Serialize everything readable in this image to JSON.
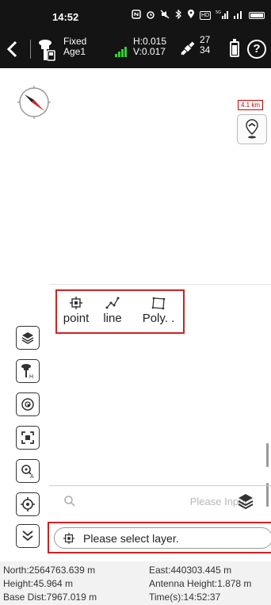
{
  "status_bar": {
    "time": "14:52",
    "icons": [
      "nfc-icon",
      "alarm-icon",
      "mute-icon",
      "bluetooth-icon",
      "location-icon",
      "hd-icon",
      "signal-5g-icon",
      "signal-4g-icon",
      "battery-icon"
    ],
    "hd_label": "HD",
    "net_label": "5G"
  },
  "gnss": {
    "fix": "Fixed",
    "age": "Age1",
    "h_precision": "H:0.015",
    "v_precision": "V:0.017",
    "sats_used": "27",
    "sats_visible": "34",
    "signal_level": 4,
    "accent_color": "#2fd12f"
  },
  "map": {
    "scale": "4.1 km"
  },
  "draw_types": [
    {
      "label": "point",
      "icon": "point-icon"
    },
    {
      "label": "line",
      "icon": "polyline-icon"
    },
    {
      "label": "Poly. .",
      "icon": "polygon-icon"
    }
  ],
  "search": {
    "placeholder": "Please Input"
  },
  "layer_select": {
    "label": "Please select layer."
  },
  "tools": [
    "layers-icon",
    "antenna-height-icon",
    "target-icon",
    "fit-extent-icon",
    "zoom-auto-icon",
    "crosshair-icon",
    "collapse-icon"
  ],
  "info": {
    "north": "North:2564763.639 m",
    "east": "East:440303.445 m",
    "height": "Height:45.964 m",
    "antenna_height": "Antenna Height:1.878 m",
    "base_dist": "Base Dist:7967.019 m",
    "time": "Time(s):14:52:37"
  },
  "colors": {
    "highlight": "#d42020",
    "header_bg": "#141414"
  }
}
